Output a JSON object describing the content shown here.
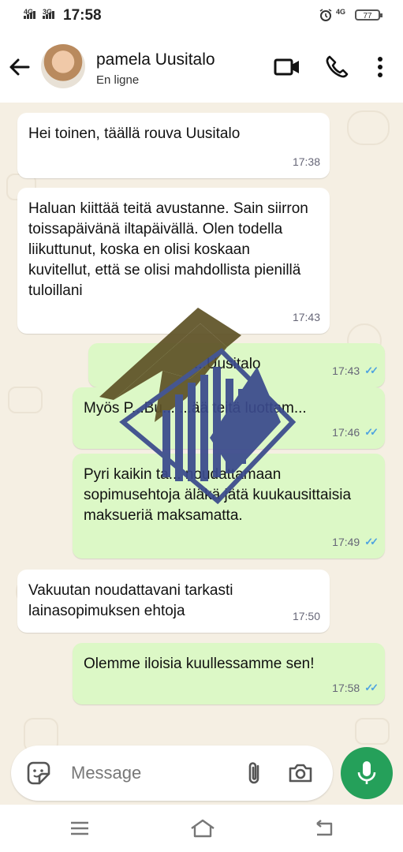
{
  "status_bar": {
    "network_1": "4G",
    "network_2": "3G",
    "time": "17:58",
    "network_right": "4G",
    "battery": "77"
  },
  "header": {
    "contact_name": "pamela Uusitalo",
    "contact_status": "En ligne"
  },
  "messages": [
    {
      "direction": "incoming",
      "text": "Hei toinen, täällä rouva Uusitalo",
      "time": "17:38"
    },
    {
      "direction": "incoming",
      "text": "Haluan kiittää teitä avustanne. Sain siirron toissapäivänä iltapäivällä. Olen todella liikuttunut, koska en olisi koskaan kuvitellut, että se olisi mahdollista pienillä tuloillani",
      "time": "17:43"
    },
    {
      "direction": "outgoing",
      "text": "...Uusitalo",
      "time": "17:43"
    },
    {
      "direction": "outgoing",
      "text": "Myös P...Bu... ...ää teitä luottam...",
      "time": "17:46"
    },
    {
      "direction": "outgoing",
      "text": "Pyri kaikin ta... noudattamaan sopimusehtoja äläkä jätä kuukausittaisia maksueriä maksamatta.",
      "time": "17:49"
    },
    {
      "direction": "incoming",
      "text": "Vakuutan noudattavani tarkasti lainasopimuksen ehtoja",
      "time": "17:50"
    },
    {
      "direction": "outgoing",
      "text": "Olemme iloisia kuullessamme sen!",
      "time": "17:58"
    }
  ],
  "composer": {
    "placeholder": "Message"
  },
  "colors": {
    "incoming_bubble": "#ffffff",
    "outgoing_bubble": "#dcf8c6",
    "send_button": "#25a05a",
    "read_ticks": "#4fa3e0",
    "logo_navy": "#3a4a8c",
    "logo_olive": "#5f5327"
  },
  "icons": {
    "back": "arrow-left-icon",
    "video": "video-camera-icon",
    "call": "phone-icon",
    "menu": "more-vertical-icon",
    "sticker": "sticker-icon",
    "attach": "paperclip-icon",
    "camera": "camera-icon",
    "mic": "microphone-icon"
  }
}
